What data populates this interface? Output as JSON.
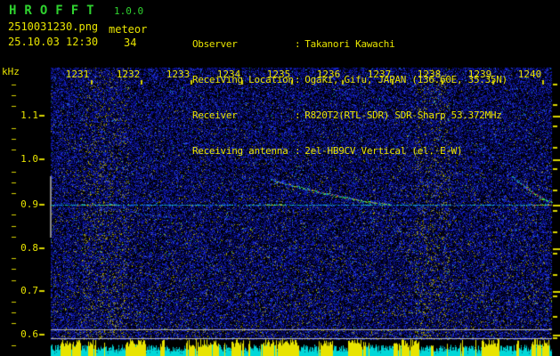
{
  "app": {
    "title": "HROFFT",
    "version": "1.0.0"
  },
  "header": {
    "filename": "2510031230.png",
    "mode_label": "meteor",
    "datetime": "25.10.03 12:30",
    "meteor_count": "34",
    "colon": ":",
    "info": [
      {
        "label": "Observer",
        "value": "Takanori Kawachi"
      },
      {
        "label": "Receiving Location",
        "value": "Ogaki, Gifu, JAPAN (136.60E, 35.35N)"
      },
      {
        "label": "Receiver",
        "value": "R820T2(RTL-SDR) SDR-Sharp 53.372MHz"
      },
      {
        "label": "Receiving antenna",
        "value": "2el-HB9CV Vertical (el. E-W)"
      }
    ]
  },
  "colors": {
    "yellow": "#e8e400",
    "green": "#2fd32f",
    "noise_blue": "#0a0f96",
    "carrier_cyan": "#22d8c8",
    "bar_cyan": "#00d8d8",
    "bar_yellow": "#e8e400",
    "guide_gray": "#b4b4b4",
    "echo_green": "#2cd24a",
    "echo_red": "#e03c10"
  },
  "chart_data": {
    "type": "heatmap",
    "title": "HROFFT radio meteor echo spectrogram 12:30-12:40",
    "x_axis": {
      "unit": "HHMM",
      "tick_labels": [
        "1231",
        "1232",
        "1233",
        "1234",
        "1235",
        "1236",
        "1237",
        "1238",
        "1239",
        "1240"
      ],
      "start": "12:30",
      "end": "12:40"
    },
    "y_axis": {
      "unit": "kHz",
      "tick_labels": [
        "1.1",
        "1.0",
        "0.9",
        "0.8",
        "0.7",
        "0.6"
      ],
      "range": [
        0.56,
        1.17
      ]
    },
    "carrier_line_khz": 0.9,
    "carrier_hot_segments_min": [
      [
        0.55,
        1.35
      ],
      [
        4.3,
        4.7
      ],
      [
        9.65,
        10.0
      ]
    ],
    "echo_traces": [
      {
        "t_start_min": 0.9,
        "f_start_khz": 0.897,
        "t_end_min": 2.4,
        "f_end_khz": 0.872,
        "strength": "faint"
      },
      {
        "t_start_min": 4.4,
        "f_start_khz": 0.957,
        "t_end_min": 6.8,
        "f_end_khz": 0.9,
        "strength": "strong"
      },
      {
        "t_start_min": 9.2,
        "f_start_khz": 0.966,
        "t_end_min": 10.0,
        "f_end_khz": 0.906,
        "strength": "strong"
      }
    ],
    "left_marker_range_khz": [
      0.824,
      0.965
    ],
    "baseline_lines_khz": [
      0.614,
      0.594
    ],
    "noise_bands_min": [
      [
        0.65,
        1.55
      ],
      [
        7.25,
        7.95
      ]
    ],
    "activity_bursts_min": [
      [
        0.2,
        0.6
      ],
      [
        0.75,
        0.9
      ],
      [
        1.5,
        1.9
      ],
      [
        2.2,
        2.3
      ],
      [
        2.7,
        3.35
      ],
      [
        3.6,
        3.85
      ],
      [
        4.2,
        4.95
      ],
      [
        5.35,
        5.65
      ],
      [
        5.95,
        6.3
      ],
      [
        6.85,
        7.35
      ],
      [
        7.6,
        7.65
      ],
      [
        8.15,
        8.25
      ],
      [
        8.6,
        8.95
      ],
      [
        9.3,
        9.35
      ],
      [
        9.6,
        9.95
      ]
    ]
  }
}
